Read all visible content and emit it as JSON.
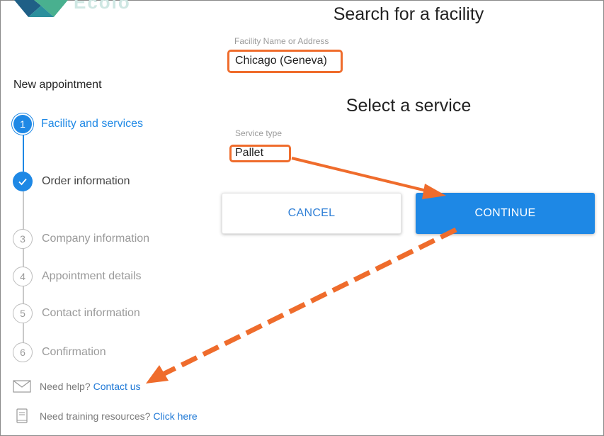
{
  "header": {
    "logo_icon": "brand-logo-icon",
    "logo_text": "Ecolo"
  },
  "facility": {
    "heading": "Search for a facility",
    "field_label": "Facility Name or Address",
    "field_value": "Chicago (Geneva)"
  },
  "service": {
    "heading": "Select a service",
    "field_label": "Service type",
    "field_value": "Pallet"
  },
  "actions": {
    "cancel_label": "CANCEL",
    "continue_label": "CONTINUE"
  },
  "sidebar": {
    "title": "New appointment",
    "steps": [
      {
        "number": "1",
        "label": "Facility and services",
        "state": "active"
      },
      {
        "number": "",
        "label": "Order information",
        "state": "done",
        "icon": "check-icon"
      },
      {
        "number": "3",
        "label": "Company information",
        "state": "pending"
      },
      {
        "number": "4",
        "label": "Appointment details",
        "state": "pending"
      },
      {
        "number": "5",
        "label": "Contact information",
        "state": "pending"
      },
      {
        "number": "6",
        "label": "Confirmation",
        "state": "pending"
      }
    ]
  },
  "help": {
    "contact_text": "Need help?",
    "contact_link": "Contact us",
    "contact_icon": "envelope-icon",
    "training_text": "Need training resources?",
    "training_link": "Click here",
    "training_icon": "book-icon"
  },
  "annotations": {
    "highlight_color": "#ef6c2c",
    "accent_color": "#1e88e5"
  }
}
